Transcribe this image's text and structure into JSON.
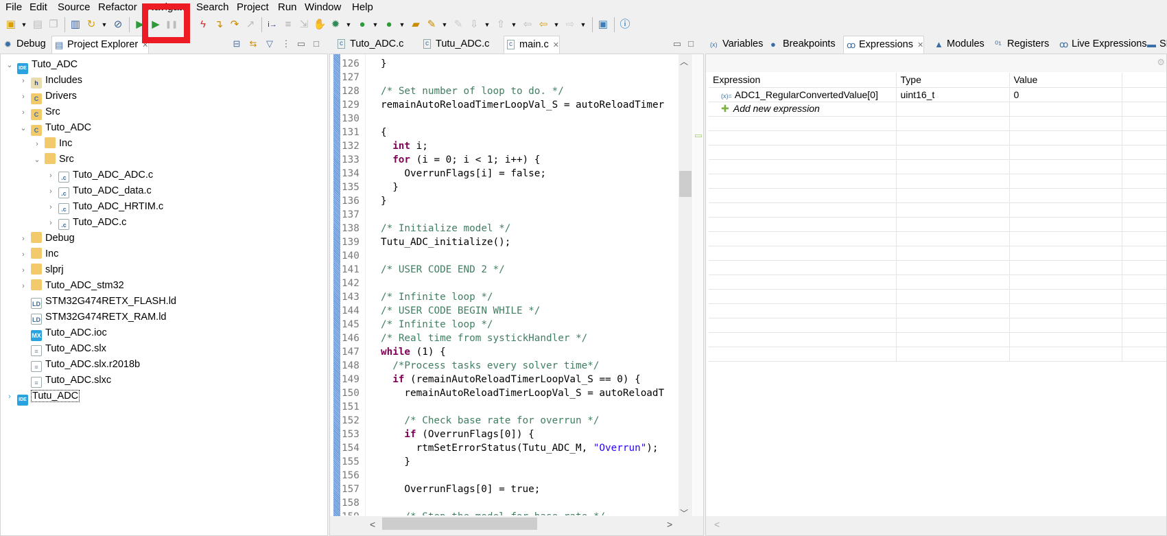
{
  "menu": [
    "File",
    "Edit",
    "Source",
    "Refactor",
    "Navigate",
    "Search",
    "Project",
    "Run",
    "Window",
    "Help"
  ],
  "toolbar": [
    {
      "icon": "new-icon",
      "dd": true
    },
    {
      "icon": "save-icon"
    },
    {
      "icon": "save-all-icon"
    },
    {
      "sep": true
    },
    {
      "icon": "binary-icon"
    },
    {
      "icon": "build-icon",
      "dd": true
    },
    {
      "icon": "skip-breakpoints-icon"
    },
    {
      "sep": true
    },
    {
      "icon": "resume-icon-highlighted"
    },
    {
      "icon": "resume-icon"
    },
    {
      "icon": "suspend-icon"
    },
    {
      "icon": "terminate-icon"
    },
    {
      "icon": "disconnect-icon"
    },
    {
      "icon": "step-into-icon"
    },
    {
      "icon": "step-over-icon"
    },
    {
      "icon": "step-return-icon"
    },
    {
      "sep": true
    },
    {
      "icon": "instruction-step-icon"
    },
    {
      "icon": "use-step-filters-icon"
    },
    {
      "icon": "drop-to-frame-icon"
    },
    {
      "icon": "hand-icon"
    },
    {
      "icon": "debug-icon",
      "dd": true
    },
    {
      "icon": "run-icon",
      "dd": true
    },
    {
      "icon": "external-tools-icon",
      "dd": true
    },
    {
      "icon": "open-folder-icon"
    },
    {
      "icon": "pen-icon",
      "dd": true
    },
    {
      "icon": "pen-disabled-icon"
    },
    {
      "icon": "next-annotation-icon",
      "dd": true
    },
    {
      "icon": "prev-annotation-icon",
      "dd": true
    },
    {
      "icon": "last-edit-icon"
    },
    {
      "icon": "back-icon",
      "dd": true
    },
    {
      "icon": "forward-icon",
      "dd": true
    },
    {
      "sep": true
    },
    {
      "icon": "perspective-icon"
    },
    {
      "sep": true
    },
    {
      "icon": "info-icon"
    }
  ],
  "left_tabs": [
    {
      "label": "Debug",
      "icon": "bug-icon"
    },
    {
      "label": "Project Explorer",
      "icon": "project-explorer-icon",
      "active": true
    }
  ],
  "tree": [
    {
      "label": "Tuto_ADC",
      "level": 0,
      "state": "open",
      "icon": "ide-error"
    },
    {
      "label": "Includes",
      "level": 1,
      "state": "closed",
      "icon": "includes"
    },
    {
      "label": "Drivers",
      "level": 1,
      "state": "closed",
      "icon": "srcfolder-error"
    },
    {
      "label": "Src",
      "level": 1,
      "state": "closed",
      "icon": "srcfolder"
    },
    {
      "label": "Tuto_ADC",
      "level": 1,
      "state": "open",
      "icon": "srcfolder"
    },
    {
      "label": "Inc",
      "level": 2,
      "state": "closed",
      "icon": "folder"
    },
    {
      "label": "Src",
      "level": 2,
      "state": "open",
      "icon": "folder"
    },
    {
      "label": "Tuto_ADC_ADC.c",
      "level": 3,
      "state": "closed",
      "icon": "cfile"
    },
    {
      "label": "Tuto_ADC_data.c",
      "level": 3,
      "state": "closed",
      "icon": "cfile"
    },
    {
      "label": "Tuto_ADC_HRTIM.c",
      "level": 3,
      "state": "closed",
      "icon": "cfile"
    },
    {
      "label": "Tuto_ADC.c",
      "level": 3,
      "state": "closed",
      "icon": "cfile"
    },
    {
      "label": "Debug",
      "level": 1,
      "state": "closed",
      "icon": "folder"
    },
    {
      "label": "Inc",
      "level": 1,
      "state": "closed",
      "icon": "folder"
    },
    {
      "label": "slprj",
      "level": 1,
      "state": "closed",
      "icon": "folder"
    },
    {
      "label": "Tuto_ADC_stm32",
      "level": 1,
      "state": "closed",
      "icon": "folder"
    },
    {
      "label": "STM32G474RETX_FLASH.ld",
      "level": 1,
      "state": "none",
      "icon": "ld"
    },
    {
      "label": "STM32G474RETX_RAM.ld",
      "level": 1,
      "state": "none",
      "icon": "ld"
    },
    {
      "label": "Tuto_ADC.ioc",
      "level": 1,
      "state": "none",
      "icon": "mx"
    },
    {
      "label": "Tuto_ADC.slx",
      "level": 1,
      "state": "none",
      "icon": "text"
    },
    {
      "label": "Tuto_ADC.slx.r2018b",
      "level": 1,
      "state": "none",
      "icon": "text"
    },
    {
      "label": "Tuto_ADC.slxc",
      "level": 1,
      "state": "none",
      "icon": "text"
    },
    {
      "label": "Tutu_ADC",
      "level": 0,
      "state": "closed",
      "icon": "ide-warning",
      "focused": true
    }
  ],
  "editor_tabs": [
    {
      "label": "Tuto_ADC.c"
    },
    {
      "label": "Tutu_ADC.c"
    },
    {
      "label": "main.c",
      "active": true
    }
  ],
  "code": [
    {
      "n": 126,
      "ind": 0,
      "t": [
        [
          "pl",
          "}"
        ]
      ]
    },
    {
      "n": 127,
      "ind": 0,
      "t": []
    },
    {
      "n": 128,
      "ind": 0,
      "t": [
        [
          "cm",
          "/* Set number of loop to do. */"
        ]
      ]
    },
    {
      "n": 129,
      "ind": 0,
      "t": [
        [
          "pl",
          "remainAutoReloadTimerLoopVal_S = autoReloadTimer"
        ]
      ]
    },
    {
      "n": 130,
      "ind": 0,
      "t": []
    },
    {
      "n": 131,
      "ind": 0,
      "t": [
        [
          "pl",
          "{"
        ]
      ]
    },
    {
      "n": 132,
      "ind": 2,
      "t": [
        [
          "kw",
          "int"
        ],
        [
          "pl",
          " i;"
        ]
      ]
    },
    {
      "n": 133,
      "ind": 2,
      "t": [
        [
          "kw",
          "for"
        ],
        [
          "pl",
          " (i = 0; i < 1; i++) {"
        ]
      ]
    },
    {
      "n": 134,
      "ind": 4,
      "t": [
        [
          "pl",
          "OverrunFlags[i] = false;"
        ]
      ]
    },
    {
      "n": 135,
      "ind": 2,
      "t": [
        [
          "pl",
          "}"
        ]
      ]
    },
    {
      "n": 136,
      "ind": 0,
      "t": [
        [
          "pl",
          "}"
        ]
      ]
    },
    {
      "n": 137,
      "ind": 0,
      "t": []
    },
    {
      "n": 138,
      "ind": 0,
      "t": [
        [
          "cm",
          "/* Initialize model */"
        ]
      ]
    },
    {
      "n": 139,
      "ind": 0,
      "t": [
        [
          "pl",
          "Tutu_ADC_initialize();"
        ]
      ]
    },
    {
      "n": 140,
      "ind": 0,
      "t": []
    },
    {
      "n": 141,
      "ind": 0,
      "t": [
        [
          "cm",
          "/* USER CODE END 2 */"
        ]
      ]
    },
    {
      "n": 142,
      "ind": 0,
      "t": []
    },
    {
      "n": 143,
      "ind": 0,
      "t": [
        [
          "cm",
          "/* Infinite loop */"
        ]
      ]
    },
    {
      "n": 144,
      "ind": 0,
      "t": [
        [
          "cm",
          "/* USER CODE BEGIN WHILE */"
        ]
      ]
    },
    {
      "n": 145,
      "ind": 0,
      "t": [
        [
          "cm",
          "/* Infinite loop */"
        ]
      ]
    },
    {
      "n": 146,
      "ind": 0,
      "t": [
        [
          "cm",
          "/* Real time from systickHandler */"
        ]
      ]
    },
    {
      "n": 147,
      "ind": 0,
      "t": [
        [
          "kw",
          "while"
        ],
        [
          "pl",
          " (1) {"
        ]
      ]
    },
    {
      "n": 148,
      "ind": 2,
      "t": [
        [
          "cm",
          "/*Process tasks every solver time*/"
        ]
      ]
    },
    {
      "n": 149,
      "ind": 2,
      "t": [
        [
          "kw",
          "if"
        ],
        [
          "pl",
          " (remainAutoReloadTimerLoopVal_S == 0) {"
        ]
      ]
    },
    {
      "n": 150,
      "ind": 4,
      "t": [
        [
          "pl",
          "remainAutoReloadTimerLoopVal_S = autoReloadT"
        ]
      ]
    },
    {
      "n": 151,
      "ind": 0,
      "t": []
    },
    {
      "n": 152,
      "ind": 4,
      "t": [
        [
          "cm",
          "/* Check base rate for overrun */"
        ]
      ]
    },
    {
      "n": 153,
      "ind": 4,
      "t": [
        [
          "kw",
          "if"
        ],
        [
          "pl",
          " (OverrunFlags[0]) {"
        ]
      ]
    },
    {
      "n": 154,
      "ind": 6,
      "t": [
        [
          "pl",
          "rtmSetErrorStatus(Tutu_ADC_M, "
        ],
        [
          "str",
          "\"Overrun\""
        ],
        [
          "pl",
          ");"
        ]
      ]
    },
    {
      "n": 155,
      "ind": 4,
      "t": [
        [
          "pl",
          "}"
        ]
      ]
    },
    {
      "n": 156,
      "ind": 0,
      "t": []
    },
    {
      "n": 157,
      "ind": 4,
      "t": [
        [
          "pl",
          "OverrunFlags[0] = true;"
        ]
      ]
    },
    {
      "n": 158,
      "ind": 0,
      "t": []
    },
    {
      "n": 159,
      "ind": 4,
      "t": [
        [
          "cm",
          "/* Step the model for base rate */"
        ]
      ]
    }
  ],
  "right_tabs": [
    {
      "label": "Variables",
      "icon": "variables-icon"
    },
    {
      "label": "Breakpoints",
      "icon": "breakpoints-icon"
    },
    {
      "label": "Expressions",
      "icon": "expressions-icon",
      "active": true
    },
    {
      "label": "Modules",
      "icon": "modules-icon"
    },
    {
      "label": "Registers",
      "icon": "registers-icon"
    },
    {
      "label": "Live Expressions",
      "icon": "live-expressions-icon"
    },
    {
      "label": "SF",
      "icon": "sfr-icon"
    }
  ],
  "expressions": {
    "columns": [
      "Expression",
      "Type",
      "Value"
    ],
    "rows": [
      {
        "expression": "ADC1_RegularConvertedValue[0]",
        "type": "uint16_t",
        "value": "0"
      }
    ],
    "add_label": "Add new expression"
  },
  "colors": {
    "annotation_box": "#ed1c24",
    "keyword": "#7f0055",
    "comment": "#3f7f5f",
    "string": "#2a00ff"
  }
}
